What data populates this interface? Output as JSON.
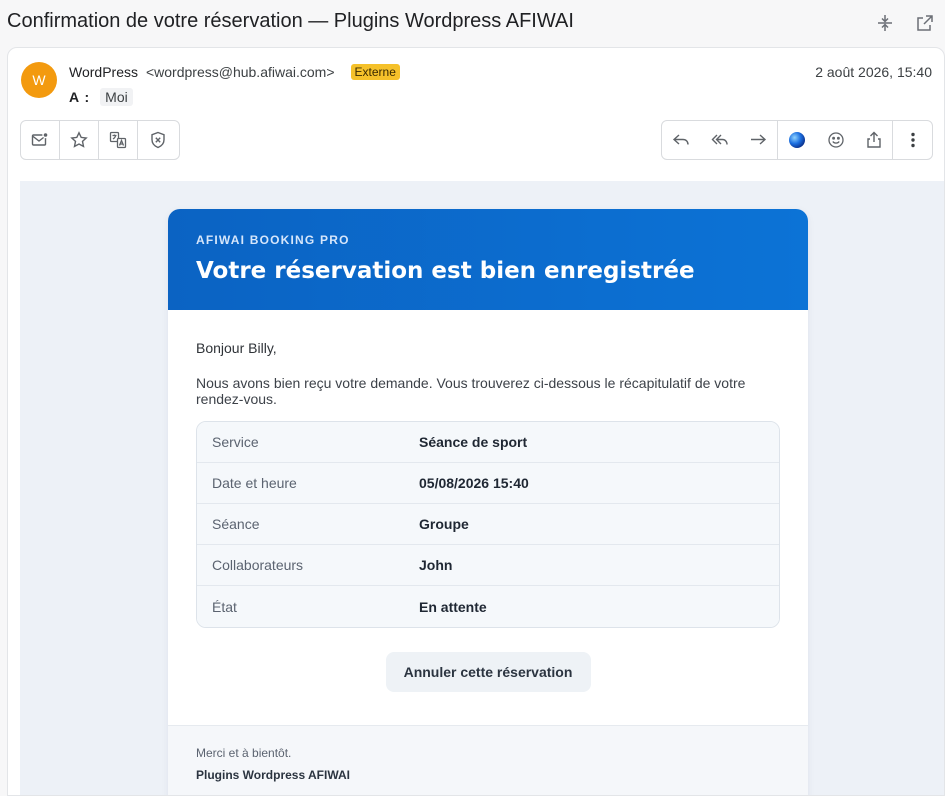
{
  "header": {
    "subject": "Confirmation de votre réservation — Plugins Wordpress AFIWAI"
  },
  "message": {
    "avatar_letter": "W",
    "from_name": "WordPress",
    "from_address": "<wordpress@hub.afiwai.com>",
    "external_badge": "Externe",
    "to_label": "A :",
    "to_recipient": "Moi",
    "date": "2 août 2026, 15:40"
  },
  "toolbar": {
    "left_icons": [
      "mark-unread-icon",
      "star-icon",
      "translate-icon",
      "shield-x-icon"
    ],
    "right_icons": [
      "reply-icon",
      "reply-all-icon",
      "forward-icon",
      "ai-orb-icon",
      "emoji-icon",
      "share-icon",
      "more-vertical-icon"
    ]
  },
  "email": {
    "brand": "AFIWAI BOOKING PRO",
    "headline": "Votre réservation est bien enregistrée",
    "greeting": "Bonjour Billy,",
    "intro": "Nous avons bien reçu votre demande. Vous trouverez ci-dessous le récapitulatif de votre rendez-vous.",
    "details": [
      {
        "label": "Service",
        "value": "Séance de sport"
      },
      {
        "label": "Date et heure",
        "value": "05/08/2026 15:40"
      },
      {
        "label": "Séance",
        "value": "Groupe"
      },
      {
        "label": "Collaborateurs",
        "value": "John"
      },
      {
        "label": "État",
        "value": "En attente"
      }
    ],
    "cancel_label": "Annuler cette réservation",
    "footer_thanks": "Merci et à bientôt.",
    "footer_signature": "Plugins Wordpress AFIWAI"
  },
  "colors": {
    "accent": "#0c6fd0",
    "avatar": "#f39a0f",
    "badge": "#f5c12a"
  }
}
